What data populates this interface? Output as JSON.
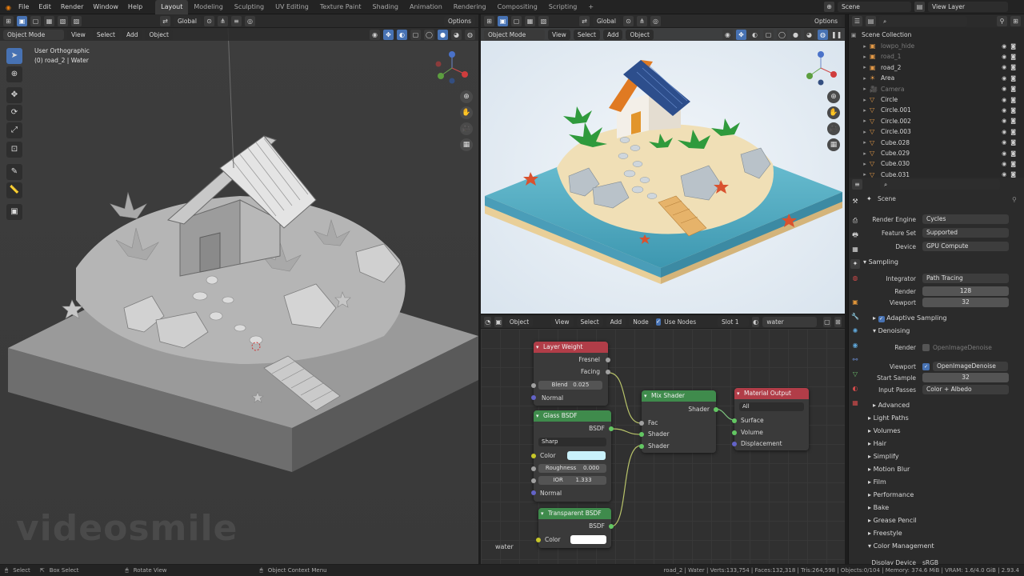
{
  "topbar": {
    "menus": [
      "File",
      "Edit",
      "Render",
      "Window",
      "Help"
    ],
    "workspaces": [
      "Layout",
      "Modeling",
      "Sculpting",
      "UV Editing",
      "Texture Paint",
      "Shading",
      "Animation",
      "Rendering",
      "Compositing",
      "Scripting"
    ],
    "active_workspace": "Layout",
    "scene": "Scene",
    "view_layer": "View Layer"
  },
  "left_view": {
    "transform": "Global",
    "options": "Options",
    "mode": "Object Mode",
    "menus": [
      "View",
      "Select",
      "Add",
      "Object"
    ],
    "overlay_line1": "User Orthographic",
    "overlay_line2": "(0) road_2 | Water",
    "watermark": "videosmile"
  },
  "right_view": {
    "transform": "Global",
    "options": "Options",
    "mode": "Object Mode",
    "menus": [
      "View",
      "Select",
      "Add",
      "Object"
    ]
  },
  "node_editor": {
    "object": "Object",
    "menus": [
      "View",
      "Select",
      "Add",
      "Node"
    ],
    "use_nodes": "Use Nodes",
    "slot": "Slot 1",
    "material": "water",
    "bottom_label": "water",
    "nodes": {
      "layer_weight": {
        "title": "Layer Weight",
        "out1": "Fresnel",
        "out2": "Facing",
        "blend_label": "Blend",
        "blend_value": "0.025",
        "normal": "Normal"
      },
      "glass": {
        "title": "Glass BSDF",
        "out": "BSDF",
        "dist": "Sharp",
        "color": "Color",
        "roughness_label": "Roughness",
        "roughness_value": "0.000",
        "ior_label": "IOR",
        "ior_value": "1.333",
        "normal": "Normal"
      },
      "transparent": {
        "title": "Transparent BSDF",
        "out": "BSDF",
        "color": "Color"
      },
      "mix": {
        "title": "Mix Shader",
        "out": "Shader",
        "fac": "Fac",
        "in1": "Shader",
        "in2": "Shader"
      },
      "output": {
        "title": "Material Output",
        "target": "All",
        "in1": "Surface",
        "in2": "Volume",
        "in3": "Displacement"
      }
    }
  },
  "outliner": {
    "root": "Scene Collection",
    "items": [
      {
        "name": "lowpo_hide",
        "dim": true
      },
      {
        "name": "road_1",
        "dim": true
      },
      {
        "name": "road_2",
        "dim": false
      },
      {
        "name": "Area",
        "dim": false
      },
      {
        "name": "Camera",
        "dim": true
      },
      {
        "name": "Circle",
        "dim": false
      },
      {
        "name": "Circle.001",
        "dim": false
      },
      {
        "name": "Circle.002",
        "dim": false
      },
      {
        "name": "Circle.003",
        "dim": false
      },
      {
        "name": "Cube.028",
        "dim": false
      },
      {
        "name": "Cube.029",
        "dim": false
      },
      {
        "name": "Cube.030",
        "dim": false
      },
      {
        "name": "Cube.031",
        "dim": false
      }
    ]
  },
  "properties": {
    "context": "Scene",
    "render_engine_label": "Render Engine",
    "render_engine": "Cycles",
    "feature_set_label": "Feature Set",
    "feature_set": "Supported",
    "device_label": "Device",
    "device": "GPU Compute",
    "sampling": "Sampling",
    "integrator_label": "Integrator",
    "integrator": "Path Tracing",
    "render_label": "Render",
    "render_samples": "128",
    "viewport_label": "Viewport",
    "viewport_samples": "32",
    "adaptive": "Adaptive Sampling",
    "denoising": "Denoising",
    "den_render_label": "Render",
    "den_render": "OpenImageDenoise",
    "den_viewport_label": "Viewport",
    "den_viewport": "OpenImageDenoise",
    "start_sample_label": "Start Sample",
    "start_sample": "32",
    "input_passes_label": "Input Passes",
    "input_passes": "Color + Albedo",
    "advanced": "Advanced",
    "panels": [
      "Light Paths",
      "Volumes",
      "Hair",
      "Simplify",
      "Motion Blur",
      "Film",
      "Performance",
      "Bake",
      "Grease Pencil",
      "Freestyle",
      "Color Management"
    ],
    "display_device_label": "Display Device",
    "display_device": "sRGB"
  },
  "statusbar": {
    "select": "Select",
    "box_select": "Box Select",
    "rotate": "Rotate View",
    "context_menu": "Object Context Menu",
    "stats": "road_2 | Water | Verts:133,754 | Faces:132,318 | Tris:264,598 | Objects:0/104 | Memory: 374.6 MiB | VRAM: 1.6/4.0 GiB | 2.93.4"
  }
}
